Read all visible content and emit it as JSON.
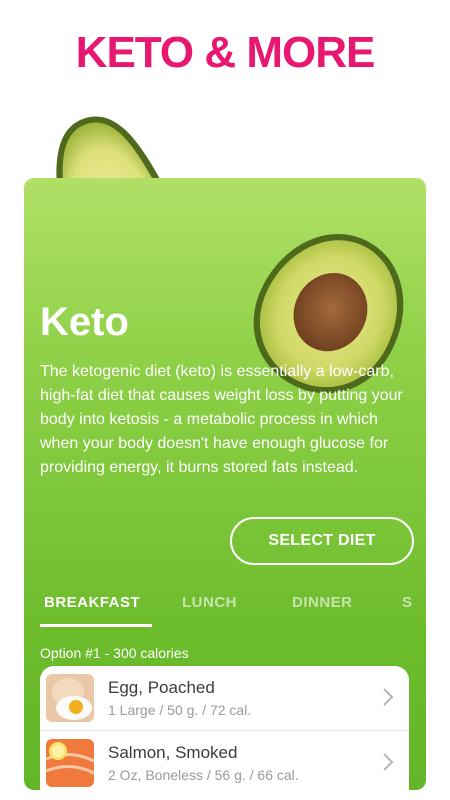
{
  "headline": "KETO & MORE",
  "diet": {
    "title": "Keto",
    "description": "The ketogenic diet (keto) is essentially a low-carb, high-fat diet that causes weight loss by putting your body into ketosis - a metabolic process in which when your body doesn't have enough glucose for providing energy, it burns stored fats instead.",
    "select_label": "SELECT DIET"
  },
  "tabs": [
    {
      "label": "BREAKFAST",
      "active": true
    },
    {
      "label": "LUNCH",
      "active": false
    },
    {
      "label": "DINNER",
      "active": false
    },
    {
      "label": "S",
      "active": false
    }
  ],
  "option": {
    "label": "Option #1 - 300 calories"
  },
  "foods": [
    {
      "name": "Egg, Poached",
      "meta": "1 Large / 50 g. / 72 cal.",
      "icon": "poached-egg-icon"
    },
    {
      "name": "Salmon, Smoked",
      "meta": "2 Oz, Boneless / 56 g. / 66 cal.",
      "icon": "smoked-salmon-icon"
    }
  ],
  "colors": {
    "headline": "#e8176f",
    "card_top": "#b0e066",
    "card_bottom": "#63b628",
    "text_on_card": "#ffffff"
  }
}
